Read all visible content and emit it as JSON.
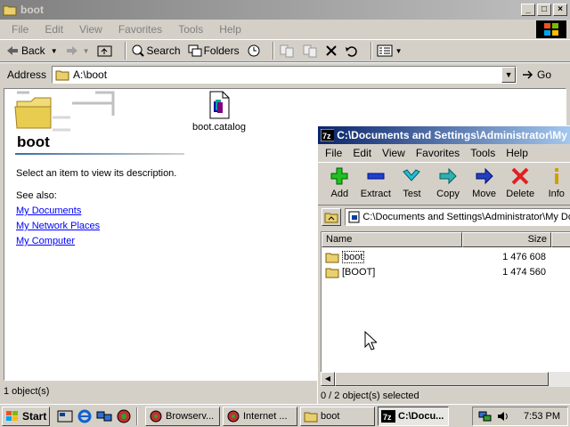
{
  "explorer": {
    "title": "boot",
    "menu": [
      "File",
      "Edit",
      "View",
      "Favorites",
      "Tools",
      "Help"
    ],
    "toolbar": {
      "back": "Back",
      "search": "Search",
      "folders": "Folders"
    },
    "address_label": "Address",
    "address_value": "A:\\boot",
    "go_label": "Go",
    "pane": {
      "title": "boot",
      "description": "Select an item to view its description.",
      "see_also": "See also:",
      "links": [
        "My Documents",
        "My Network Places",
        "My Computer"
      ]
    },
    "files": [
      {
        "name": "boot.catalog"
      }
    ],
    "status": "1 object(s)"
  },
  "sevenzip": {
    "title": "C:\\Documents and Settings\\Administrator\\My Do",
    "menu": [
      "File",
      "Edit",
      "View",
      "Favorites",
      "Tools",
      "Help"
    ],
    "tools": [
      "Add",
      "Extract",
      "Test",
      "Copy",
      "Move",
      "Delete",
      "Info"
    ],
    "path": "C:\\Documents and Settings\\Administrator\\My Do",
    "columns": {
      "name": "Name",
      "size": "Size"
    },
    "rows": [
      {
        "name": "boot",
        "size": "1 476 608"
      },
      {
        "name": "[BOOT]",
        "size": "1 474 560"
      }
    ],
    "status": "0 / 2 object(s) selected"
  },
  "taskbar": {
    "start": "Start",
    "buttons": [
      "Browserv...",
      "Internet ...",
      "boot",
      "C:\\Docu..."
    ],
    "clock": "7:53 PM"
  }
}
